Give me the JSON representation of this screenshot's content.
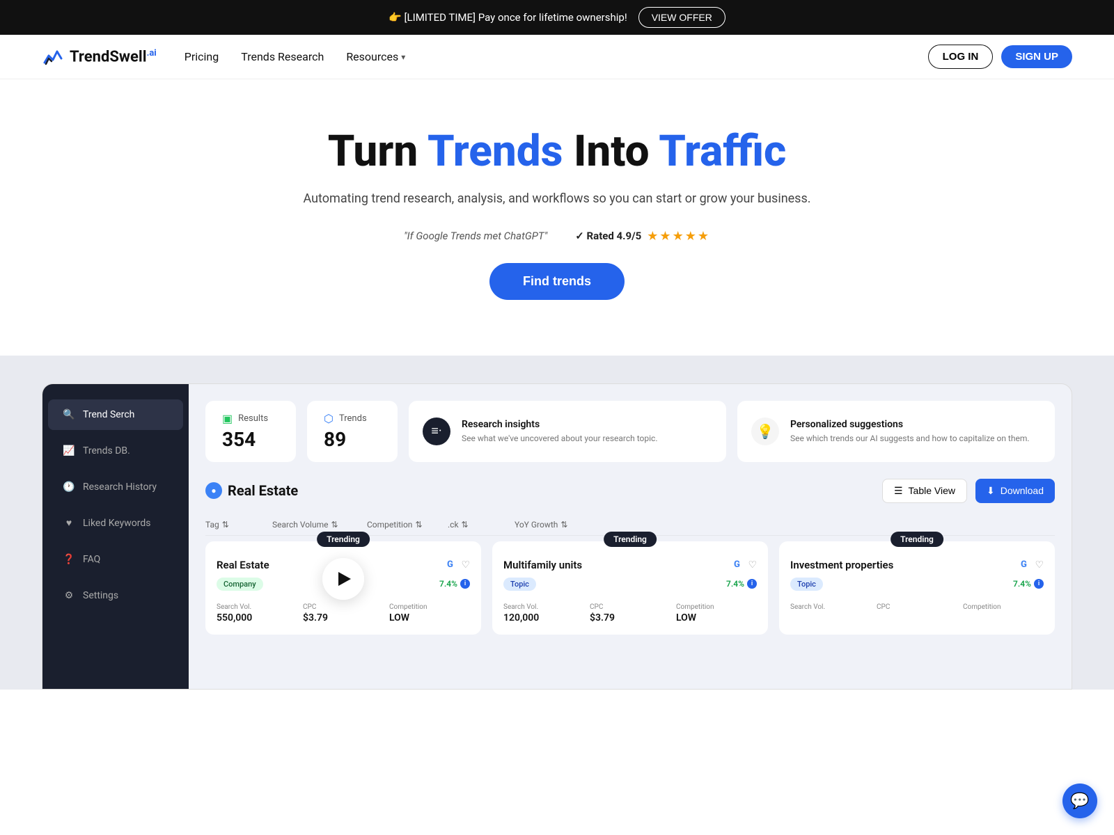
{
  "banner": {
    "text": "👉 [LIMITED TIME] Pay once for lifetime ownership!",
    "button_label": "VIEW OFFER"
  },
  "nav": {
    "logo_text": "TrendSwell",
    "logo_ai": ".ai",
    "links": [
      {
        "label": "Pricing",
        "id": "pricing"
      },
      {
        "label": "Trends Research",
        "id": "trends-research"
      },
      {
        "label": "Resources",
        "id": "resources"
      }
    ],
    "login_label": "LOG IN",
    "signup_label": "SIGN UP"
  },
  "hero": {
    "title_part1": "Turn ",
    "title_trends": "Trends",
    "title_part2": " Into ",
    "title_traffic": "Traffic",
    "subtitle": "Automating trend research, analysis, and workflows so you can\nstart or grow your business.",
    "quote": "\"If Google Trends met ChatGPT\"",
    "rating_label": "✓ Rated 4.9/5",
    "stars": "★★★★★",
    "find_trends_label": "Find trends"
  },
  "app": {
    "sidebar": {
      "items": [
        {
          "label": "Trend Serch",
          "icon": "🔍",
          "active": true
        },
        {
          "label": "Trends DB.",
          "icon": "📈",
          "active": false
        },
        {
          "label": "Research History",
          "icon": "🕐",
          "active": false
        },
        {
          "label": "Liked Keywords",
          "icon": "♥",
          "active": false
        },
        {
          "label": "FAQ",
          "icon": "❓",
          "active": false
        },
        {
          "label": "Settings",
          "icon": "⚙",
          "active": false
        }
      ]
    },
    "stats": {
      "results_label": "Results",
      "results_value": "354",
      "trends_label": "Trends",
      "trends_value": "89",
      "insights_title": "Research insights",
      "insights_desc": "See what we've uncovered about your research topic.",
      "suggestions_title": "Personalized suggestions",
      "suggestions_desc": "See which trends our AI suggests and how to capitalize on them."
    },
    "topic": {
      "title": "Real Estate",
      "table_view_label": "Table View",
      "download_label": "Download"
    },
    "columns": [
      {
        "label": "Tag",
        "id": "tag"
      },
      {
        "label": "Search Volume",
        "id": "search-volume"
      },
      {
        "label": "Competition",
        "id": "competition"
      },
      {
        "label": ".ck",
        "id": "ck"
      },
      {
        "label": "YoY Growth",
        "id": "yoy-growth"
      }
    ],
    "keywords": [
      {
        "badge": "Trending",
        "name": "Real Estate",
        "tag": "Company",
        "tag_type": "company",
        "growth": "7.4%",
        "search_vol_label": "Search Vol.",
        "search_vol": "550,000",
        "cpc_label": "CPC",
        "cpc": "$3.79",
        "competition_label": "Competition",
        "competition": "LOW"
      },
      {
        "badge": "Trending",
        "name": "Multifamily units",
        "tag": "Topic",
        "tag_type": "topic",
        "growth": "7.4%",
        "search_vol_label": "Search Vol.",
        "search_vol": "120,000",
        "cpc_label": "CPC",
        "cpc": "$3.79",
        "competition_label": "Competition",
        "competition": "LOW"
      },
      {
        "badge": "Trending",
        "name": "Investment properties",
        "tag": "Topic",
        "tag_type": "topic",
        "growth": "7.4%",
        "search_vol_label": "Search Vol.",
        "search_vol": "",
        "cpc_label": "CPC",
        "cpc": "",
        "competition_label": "Competition",
        "competition": ""
      }
    ]
  },
  "chat_icon": "💬"
}
